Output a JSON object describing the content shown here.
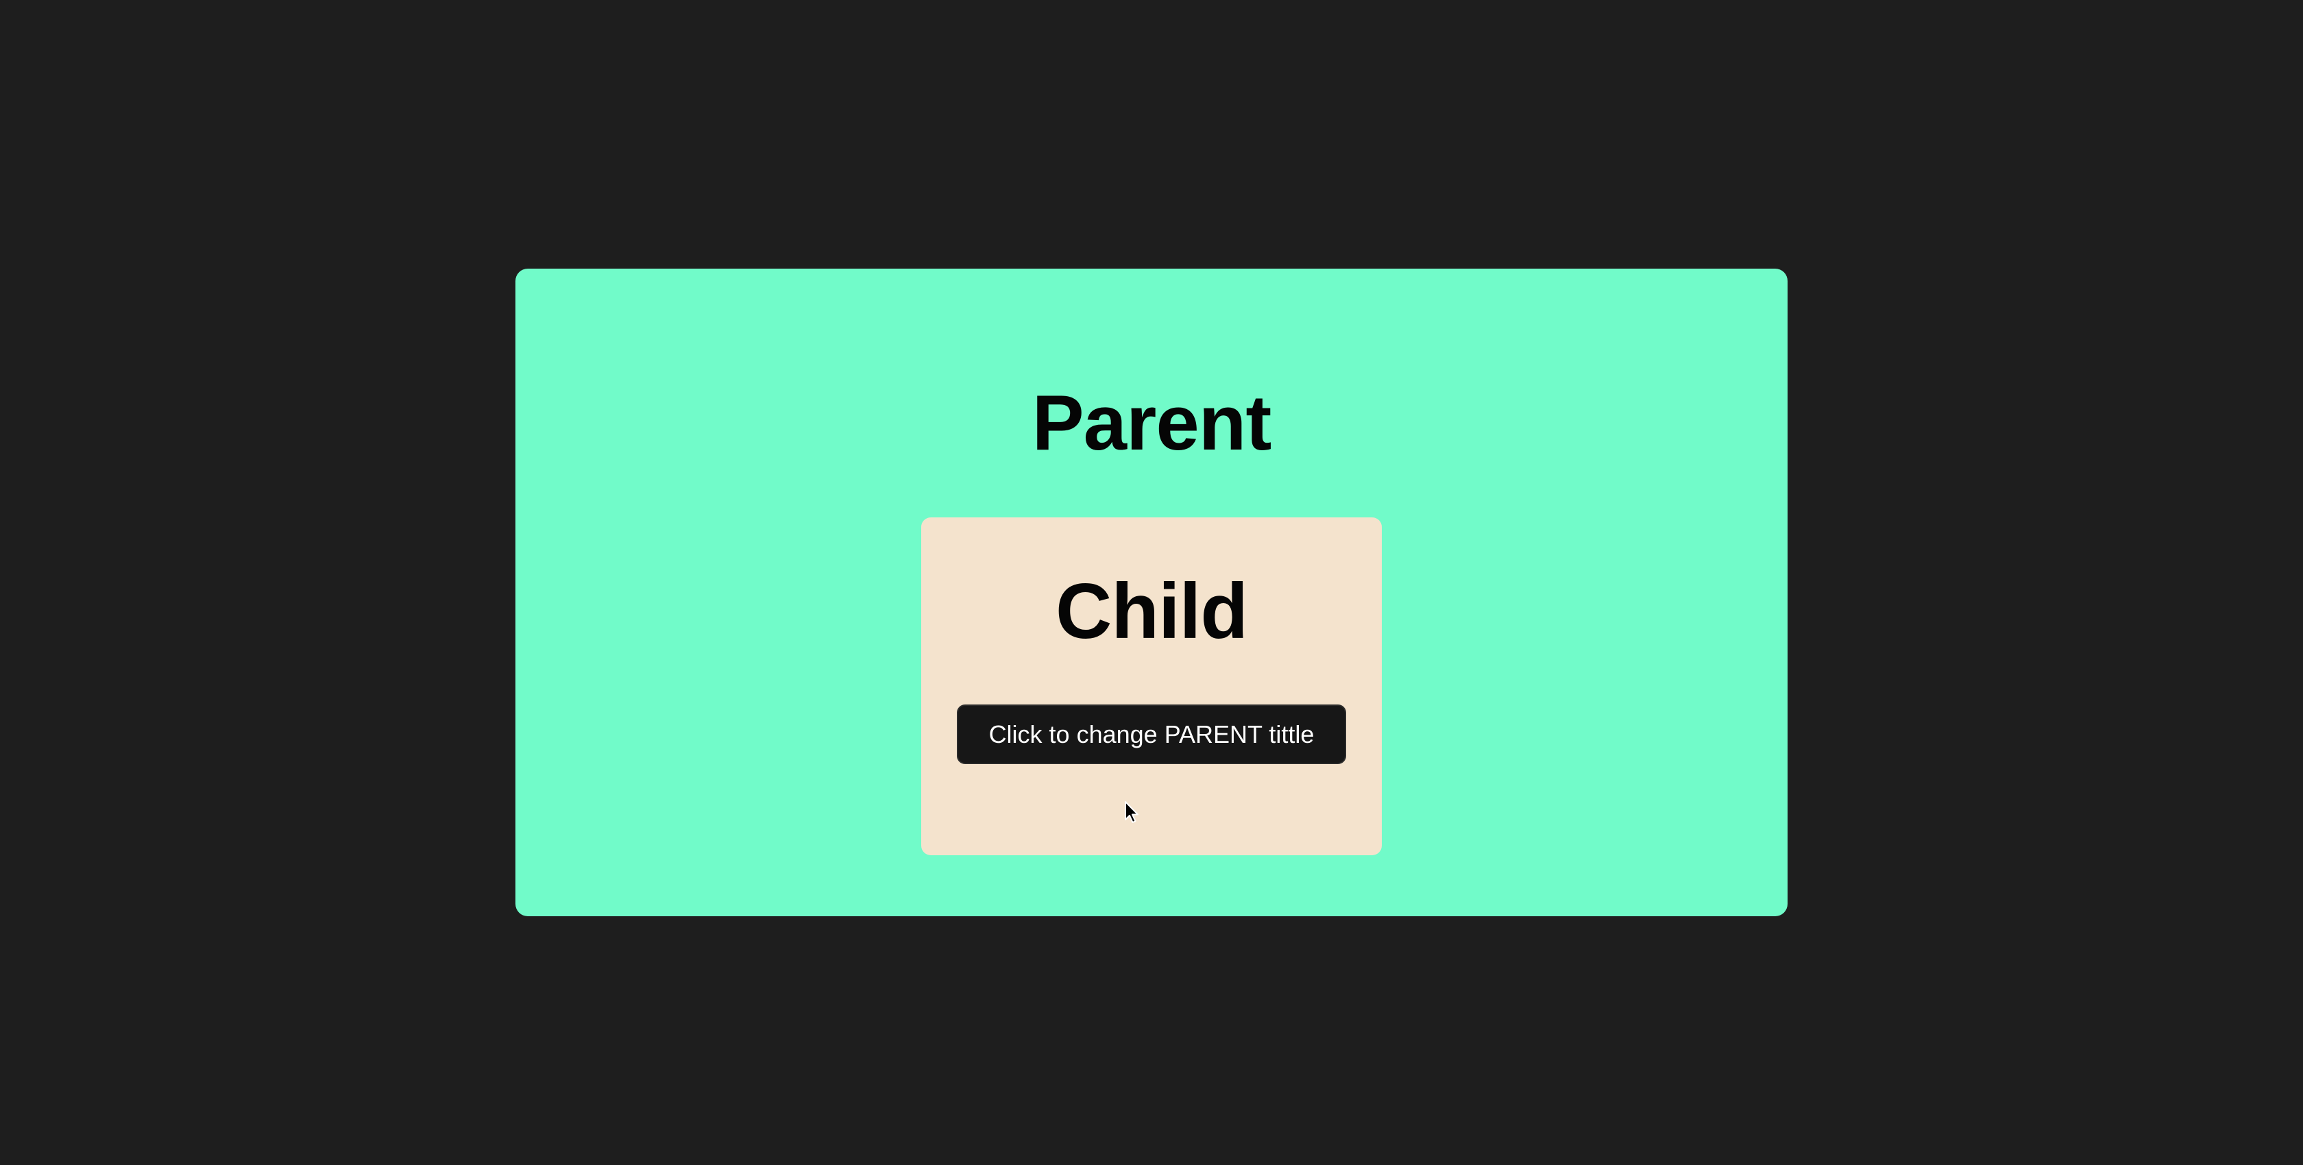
{
  "parent": {
    "title": "Parent"
  },
  "child": {
    "title": "Child",
    "button_label": "Click to change PARENT tittle"
  },
  "colors": {
    "page_background": "#1e1e1e",
    "parent_background": "#71fbc9",
    "child_background": "#f4e3cd",
    "button_background": "#171717",
    "button_text": "#ffffff",
    "title_text": "#050505"
  },
  "icons": {
    "cursor": "mouse-pointer-icon"
  }
}
